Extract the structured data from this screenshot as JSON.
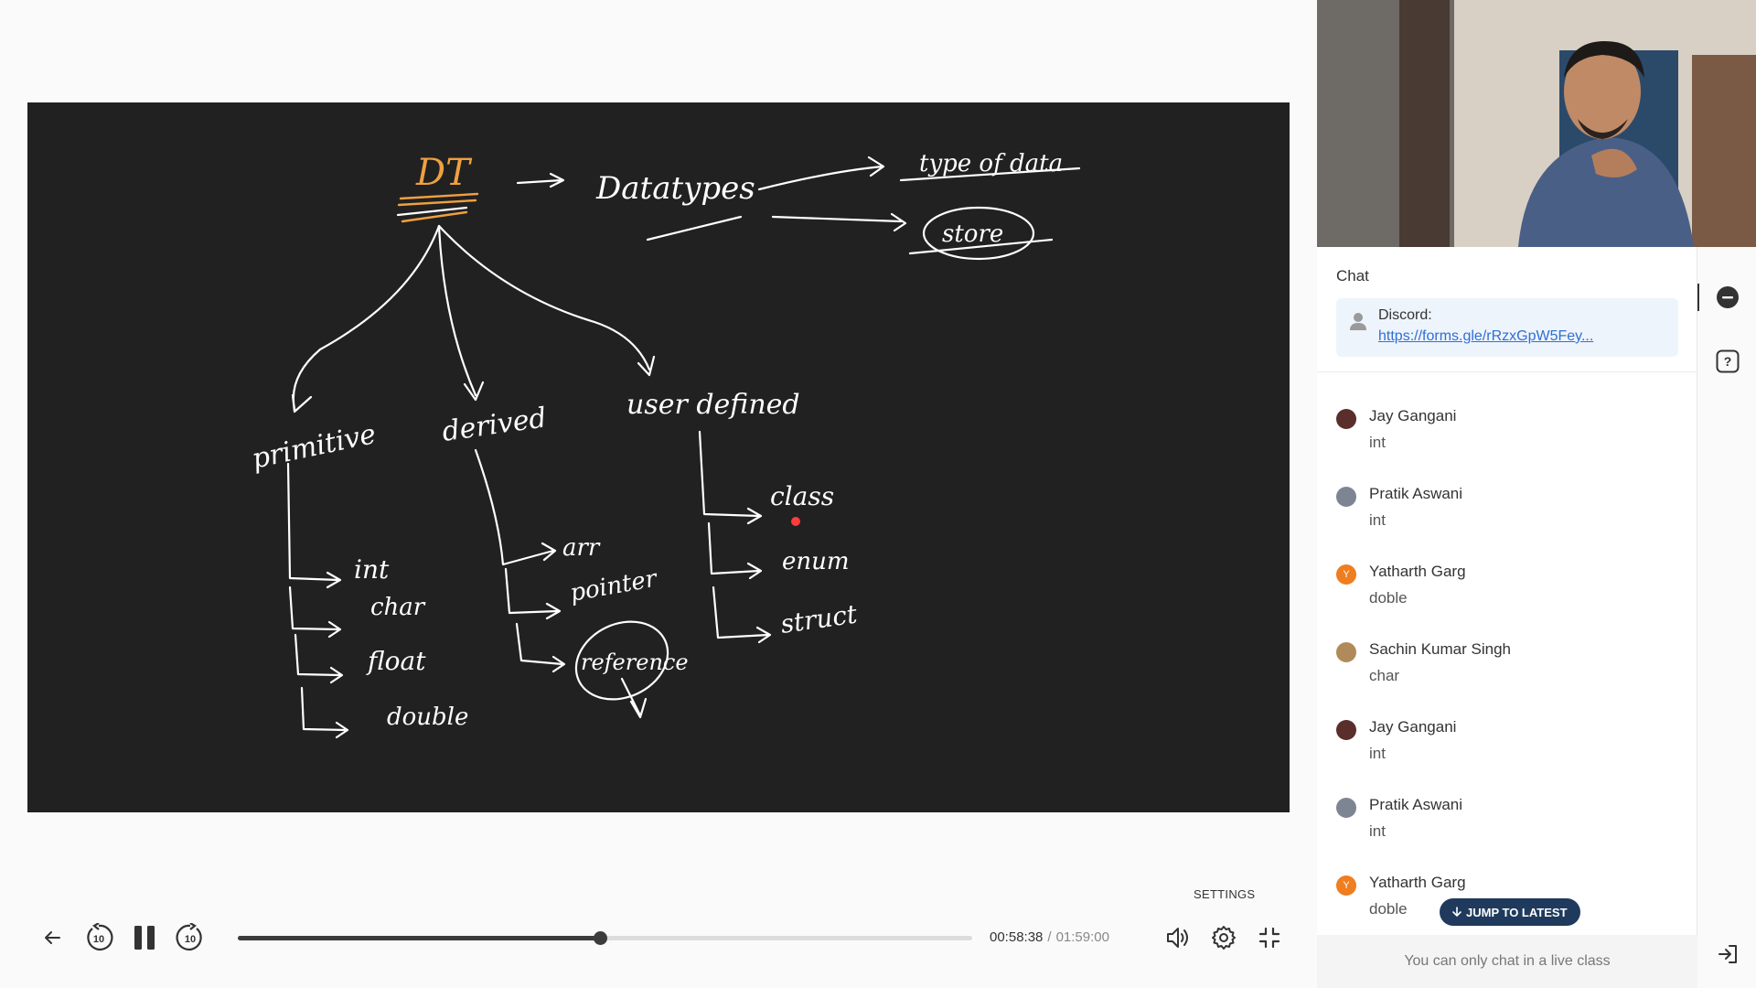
{
  "chat": {
    "title": "Chat",
    "pinned": {
      "sender": "Discord:",
      "link": "https://forms.gle/rRzxGpW5Fey..."
    },
    "messages": [
      {
        "name": "Jay Gangani",
        "text": "int",
        "avatar": "photo"
      },
      {
        "name": "Pratik Aswani",
        "text": "int",
        "avatar": "photo"
      },
      {
        "name": "Yatharth Garg",
        "text": "doble",
        "avatar": "Y"
      },
      {
        "name": "Sachin Kumar Singh",
        "text": "char",
        "avatar": "photo"
      },
      {
        "name": "Jay Gangani",
        "text": "int",
        "avatar": "photo"
      },
      {
        "name": "Pratik Aswani",
        "text": "int",
        "avatar": "photo"
      },
      {
        "name": "Yatharth Garg",
        "text": "doble",
        "avatar": "Y"
      }
    ],
    "jump_label": "JUMP TO LATEST",
    "footer": "You can only chat in a live class"
  },
  "player": {
    "current_time": "00:58:38",
    "separator": "/",
    "duration": "01:59:00",
    "progress": 0.4928,
    "settings_tooltip": "SETTINGS",
    "skip_seconds": "10"
  },
  "colors": {
    "board": "#212121",
    "ink": "#ffffff",
    "accent_ink": "#f0a040",
    "jump_button": "#1f3a5c",
    "link": "#2f6fd6",
    "letter_avatar": "#f07d1f"
  },
  "icons": [
    "back-arrow-icon",
    "rewind-10-icon",
    "pause-icon",
    "forward-10-icon",
    "volume-icon",
    "gear-icon",
    "exit-fullscreen-icon",
    "chat-icon",
    "help-icon",
    "logout-icon"
  ]
}
